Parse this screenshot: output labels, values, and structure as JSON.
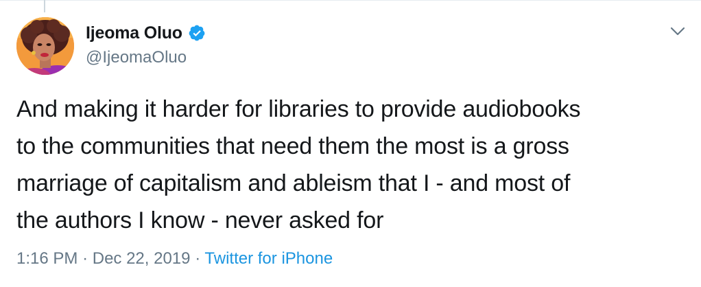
{
  "tweet": {
    "author": {
      "name": "Ijeoma Oluo",
      "handle": "@IjeomaOluo",
      "verified": true
    },
    "text_lines": [
      "And making it harder for libraries to provide audiobooks",
      "to the communities that need them the most is a gross",
      "marriage of capitalism and ableism that I - and most of",
      "the authors I know - never asked for"
    ],
    "time": "1:16 PM",
    "separator": "·",
    "date": "Dec 22, 2019",
    "source": "Twitter for iPhone"
  },
  "icons": {
    "verified": "verified-badge-icon",
    "menu": "chevron-down-icon"
  },
  "colors": {
    "text": "#14171a",
    "secondary": "#657786",
    "link": "#1b95e0",
    "verified": "#1da1f2"
  }
}
